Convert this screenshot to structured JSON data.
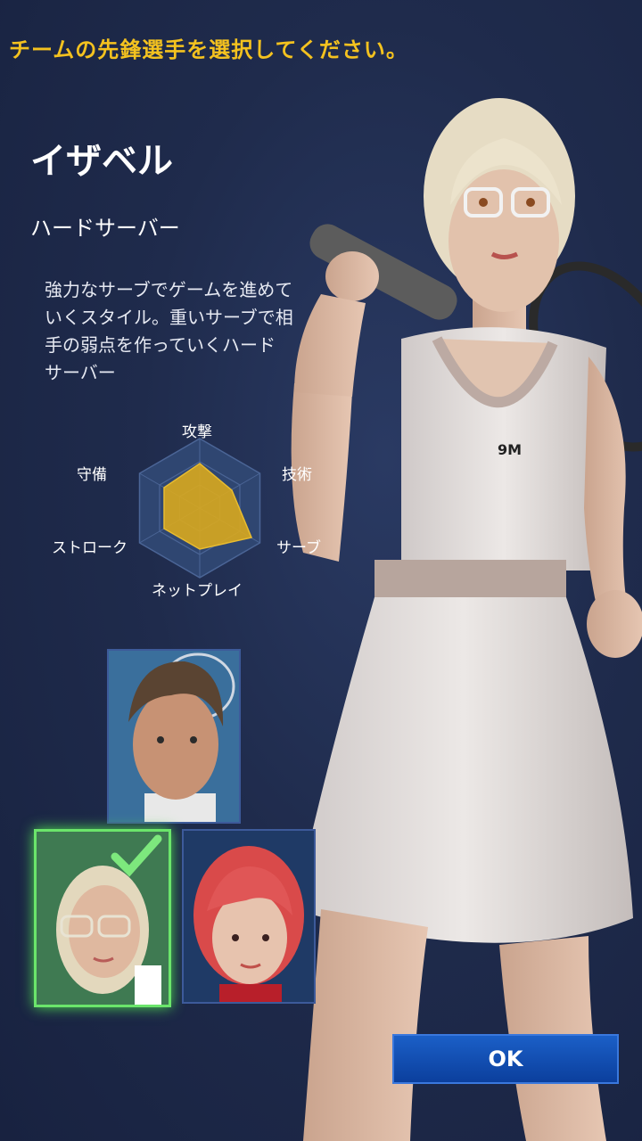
{
  "header": {
    "instruction": "チームの先鋒選手を選択してください。"
  },
  "player": {
    "name": "イザベル",
    "role": "ハードサーバー",
    "description_lines": [
      "強力なサーブでゲームを進めて",
      "いくスタイル。重いサーブで相",
      "手の弱点を作っていくハード",
      "サーバー"
    ]
  },
  "radar": {
    "labels": {
      "attack": "攻撃",
      "technique": "技術",
      "serve": "サーブ",
      "netplay": "ネットプレイ",
      "stroke": "ストローク",
      "defense": "守備"
    },
    "fill_color": "#d9a91e"
  },
  "roster": [
    {
      "name": "male-player",
      "selected": false
    },
    {
      "name": "isabel",
      "selected": true
    },
    {
      "name": "red-hair-player",
      "selected": false
    }
  ],
  "buttons": {
    "ok": "OK"
  },
  "colors": {
    "accent": "#f4c21f",
    "button": "#1b5fc7",
    "selected": "#6be56b"
  }
}
